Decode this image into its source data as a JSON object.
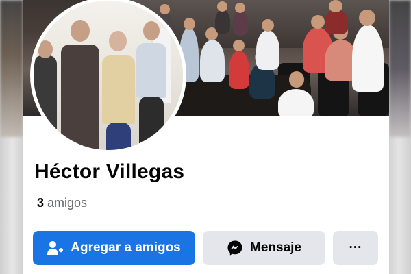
{
  "profile": {
    "name": "Héctor Villegas",
    "friends_count": "3",
    "friends_label": "amigos"
  },
  "actions": {
    "add_friend_label": "Agregar a amigos",
    "message_label": "Mensaje",
    "more_label": "···"
  },
  "icons": {
    "add_friend": "add-friend-icon",
    "messenger": "messenger-icon",
    "more": "more-dots-icon"
  },
  "colors": {
    "primary_button": "#1b74e4",
    "secondary_button": "#e4e6eb",
    "name_text": "#050505",
    "muted_text": "#65676b"
  }
}
